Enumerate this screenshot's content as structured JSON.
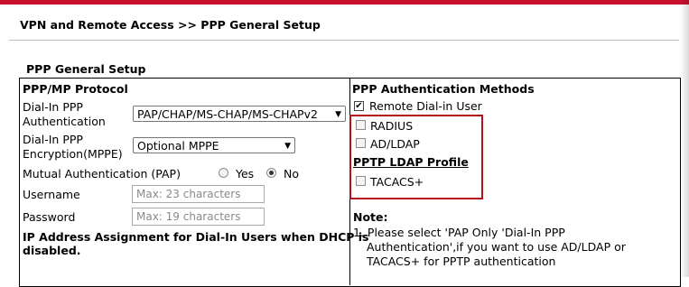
{
  "page": {
    "title": "VPN and Remote Access >> PPP General Setup",
    "section_title": "PPP General Setup"
  },
  "left": {
    "heading": "PPP/MP Protocol",
    "dialin_auth_label_1": "Dial-In PPP",
    "dialin_auth_label_2": "Authentication",
    "dialin_auth_value": "PAP/CHAP/MS-CHAP/MS-CHAPv2",
    "dialin_enc_label_1": "Dial-In PPP",
    "dialin_enc_label_2": "Encryption(MPPE)",
    "dialin_enc_value": "Optional MPPE",
    "mutual_auth_label": "Mutual Authentication (PAP)",
    "yes_label": "Yes",
    "no_label": "No",
    "mutual_auth_selected": "No",
    "username_label": "Username",
    "username_placeholder": "Max: 23 characters",
    "password_label": "Password",
    "password_placeholder": "Max: 19 characters",
    "ip_assign_line_1": "IP Address Assignment for Dial-In Users when DHCP is",
    "ip_assign_line_2": "disabled."
  },
  "right": {
    "heading": "PPP Authentication Methods",
    "remote_dialin_label": "Remote Dial-in User",
    "remote_dialin_checked": true,
    "radius_label": "RADIUS",
    "radius_checked": false,
    "adldap_label": "AD/LDAP",
    "adldap_checked": false,
    "pptp_ldap_profile": "PPTP LDAP Profile",
    "tacacs_label": "TACACS+",
    "tacacs_checked": false,
    "note_heading": "Note:",
    "note_line_1": "1. Please select 'PAP Only 'Dial-In PPP",
    "note_line_2": "Authentication',if you want to use AD/LDAP or",
    "note_line_3": "TACACS+ for PPTP authentication"
  },
  "colors": {
    "accent_red": "#c8102e",
    "highlight_box": "#b5121b"
  },
  "icons": {
    "checkbox_checked": "checkmark-icon",
    "dropdown": "chevron-down-icon"
  }
}
